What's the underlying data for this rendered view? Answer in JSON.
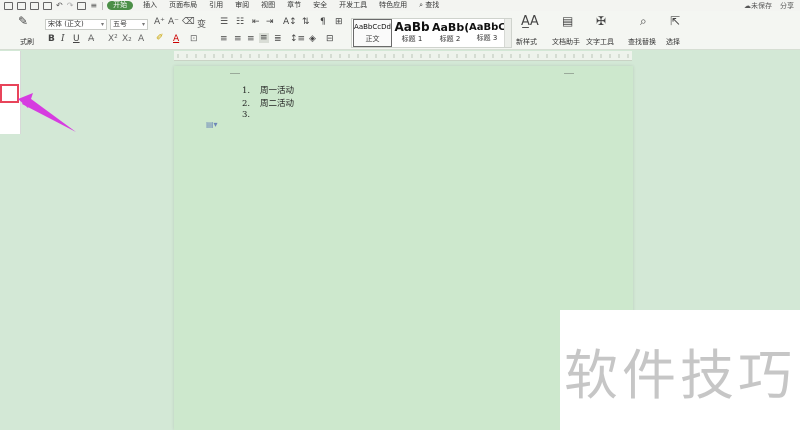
{
  "menubar": {
    "tabs": [
      "开始",
      "插入",
      "页面布局",
      "引用",
      "审阅",
      "视图",
      "章节",
      "安全",
      "开发工具",
      "特色应用"
    ],
    "active_tab": "开始",
    "search": "查找",
    "save_status": "未保存",
    "share": "分享"
  },
  "ribbon": {
    "format_painter": "式刷",
    "font_name": "宋体 (正文)",
    "font_size": "五号",
    "bold": "B",
    "italic": "I",
    "underline": "U",
    "font_color": "A",
    "styles": [
      {
        "sample": "AaBbCcDd",
        "name": "正文"
      },
      {
        "sample": "AaBb",
        "name": "标题 1"
      },
      {
        "sample": "AaBb(",
        "name": "标题 2"
      },
      {
        "sample": "AaBbC",
        "name": "标题 3"
      }
    ],
    "new_style": "新样式",
    "doc_helper": "文档助手",
    "text_tools": "文字工具",
    "find_replace": "查找替换",
    "select": "选择"
  },
  "document": {
    "list": [
      {
        "num": "1.",
        "text": "周一活动"
      },
      {
        "num": "2.",
        "text": "周二活动"
      },
      {
        "num": "3.",
        "text": ""
      }
    ]
  },
  "watermark": {
    "text": "软件技巧"
  },
  "colors": {
    "accent": "#4b8f47",
    "highlight": "#e8445a",
    "arrow": "#d63ce0",
    "page": "#cde8cd"
  }
}
